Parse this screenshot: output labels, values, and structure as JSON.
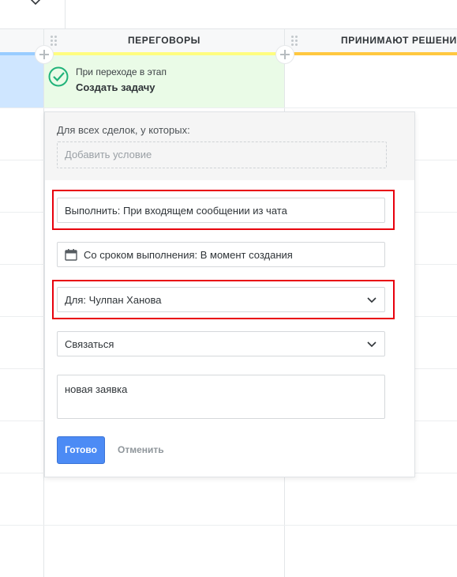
{
  "columns": [
    {
      "title": ""
    },
    {
      "title": "ПЕРЕГОВОРЫ",
      "color": "#fffd7f"
    },
    {
      "title": "ПРИНИМАЮТ РЕШЕНИ",
      "color": "#ffc840"
    }
  ],
  "trigger": {
    "line1": "При переходе в этап",
    "line2": "Создать задачу",
    "accent": "#21b37a"
  },
  "popup": {
    "condition_label": "Для всех сделок, у которых:",
    "add_condition": "Добавить условие",
    "execute": "Выполнить: При входящем сообщении из чата",
    "deadline": "Со сроком выполнения: В момент создания",
    "assignee": "Для: Чулпан Ханова",
    "task_type": "Связаться",
    "comment": "новая заявка",
    "ok_label": "Готово",
    "cancel_label": "Отменить"
  },
  "colors": {
    "highlight": "#e8000d",
    "primary_button": "#4c8bf5"
  }
}
